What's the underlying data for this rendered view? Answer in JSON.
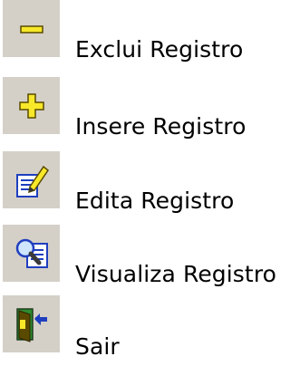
{
  "actions": [
    {
      "label": "Exclui Registro",
      "icon": "minus-icon"
    },
    {
      "label": "Insere Registro",
      "icon": "plus-icon"
    },
    {
      "label": "Edita Registro",
      "icon": "edit-document-icon"
    },
    {
      "label": "Visualiza Registro",
      "icon": "view-document-icon"
    },
    {
      "label": "Sair",
      "icon": "exit-door-icon"
    }
  ],
  "colors": {
    "tile_background": "#d4d0c8",
    "icon_yellow": "#f7e82a",
    "icon_outline": "#5a4a00",
    "icon_blue": "#1f3fbf",
    "icon_green": "#2e8b2e"
  }
}
